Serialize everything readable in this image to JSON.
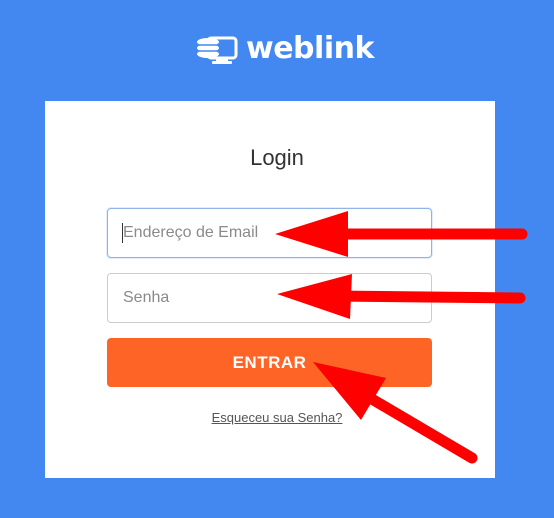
{
  "brand": {
    "logo_text": "weblink"
  },
  "login": {
    "title": "Login",
    "email_placeholder": "Endereço de Email",
    "password_placeholder": "Senha",
    "submit_label": "ENTRAR",
    "forgot_label": "Esqueceu sua Senha?"
  },
  "colors": {
    "background": "#4288f0",
    "card": "#ffffff",
    "button": "#ff6427",
    "annotation_arrow": "#ff0000"
  },
  "annotations": [
    "arrow-to-email-field",
    "arrow-to-password-field",
    "arrow-to-submit-button"
  ]
}
